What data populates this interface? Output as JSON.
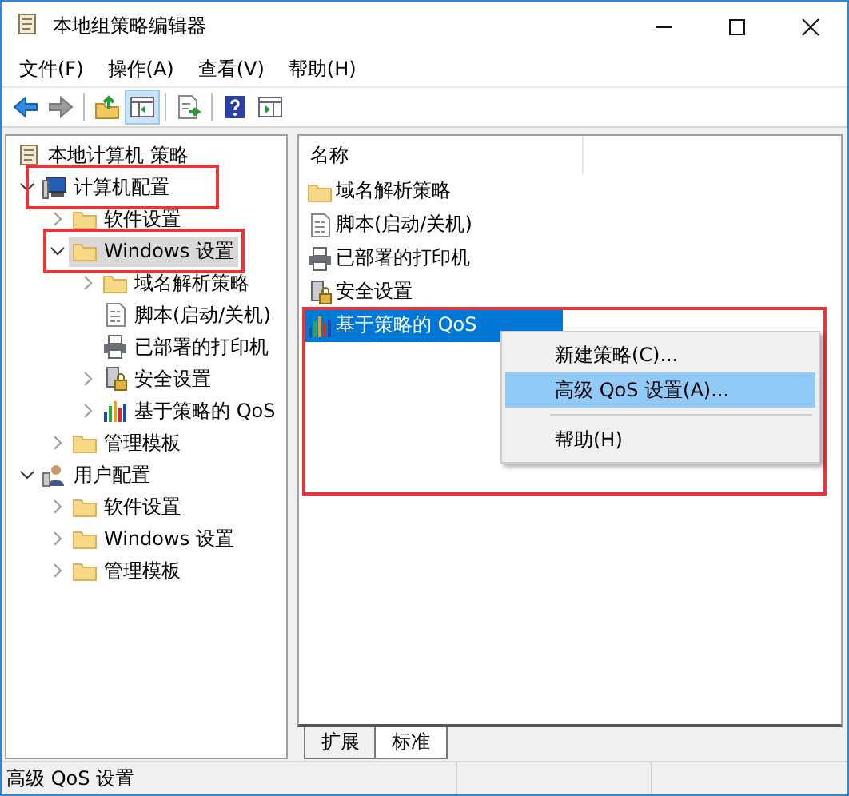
{
  "window": {
    "title": "本地组策略编辑器"
  },
  "menu": [
    "文件(F)",
    "操作(A)",
    "查看(V)",
    "帮助(H)"
  ],
  "toolbar": [
    {
      "kind": "back",
      "disabled": false,
      "pressed": false
    },
    {
      "kind": "forward",
      "disabled": true,
      "pressed": false
    },
    {
      "kind": "sep"
    },
    {
      "kind": "up",
      "disabled": false,
      "pressed": false
    },
    {
      "kind": "tree",
      "disabled": false,
      "pressed": true
    },
    {
      "kind": "sep"
    },
    {
      "kind": "export",
      "disabled": false,
      "pressed": false
    },
    {
      "kind": "sep"
    },
    {
      "kind": "help",
      "disabled": false,
      "pressed": false
    },
    {
      "kind": "pane",
      "disabled": false,
      "pressed": false
    }
  ],
  "tree": [
    {
      "label": "本地计算机 策略",
      "kind": "policy",
      "selected": false,
      "annotated": false,
      "children": [
        {
          "label": "计算机配置",
          "kind": "computer",
          "expanded": true,
          "selected": false,
          "annotated": true,
          "children": [
            {
              "label": "软件设置",
              "kind": "folder",
              "expanded": false,
              "selected": false,
              "annotated": false
            },
            {
              "label": "Windows 设置",
              "kind": "folder",
              "expanded": true,
              "selected": true,
              "annotated": true,
              "children": [
                {
                  "label": "域名解析策略",
                  "kind": "folder",
                  "expanded": false,
                  "selected": false,
                  "annotated": false
                },
                {
                  "label": "脚本(启动/关机)",
                  "kind": "script",
                  "selected": false,
                  "annotated": false
                },
                {
                  "label": "已部署的打印机",
                  "kind": "printer",
                  "selected": false,
                  "annotated": false
                },
                {
                  "label": "安全设置",
                  "kind": "security",
                  "expanded": false,
                  "selected": false,
                  "annotated": false
                },
                {
                  "label": "基于策略的 QoS",
                  "kind": "qos",
                  "expanded": false,
                  "selected": false,
                  "annotated": false
                }
              ]
            },
            {
              "label": "管理模板",
              "kind": "folder",
              "expanded": false,
              "selected": false,
              "annotated": false
            }
          ]
        },
        {
          "label": "用户配置",
          "kind": "user",
          "expanded": true,
          "selected": false,
          "annotated": false,
          "children": [
            {
              "label": "软件设置",
              "kind": "folder",
              "expanded": false,
              "selected": false,
              "annotated": false
            },
            {
              "label": "Windows 设置",
              "kind": "folder",
              "expanded": false,
              "selected": false,
              "annotated": false
            },
            {
              "label": "管理模板",
              "kind": "folder",
              "expanded": false,
              "selected": false,
              "annotated": false
            }
          ]
        }
      ]
    }
  ],
  "list": {
    "column": "名称",
    "annotated": true,
    "items": [
      {
        "label": "域名解析策略",
        "kind": "folder",
        "selected": false
      },
      {
        "label": "脚本(启动/关机)",
        "kind": "script",
        "selected": false
      },
      {
        "label": "已部署的打印机",
        "kind": "printer",
        "selected": false
      },
      {
        "label": "安全设置",
        "kind": "security",
        "selected": false
      },
      {
        "label": "基于策略的 QoS",
        "kind": "qos",
        "selected": true
      }
    ]
  },
  "context_menu": [
    {
      "kind": "item",
      "label": "新建策略(C)...",
      "selected": false
    },
    {
      "kind": "item",
      "label": "高级 QoS 设置(A)...",
      "selected": true
    },
    {
      "kind": "separator"
    },
    {
      "kind": "item",
      "label": "帮助(H)",
      "selected": false
    }
  ],
  "tabs": [
    {
      "label": "扩展",
      "selected": false
    },
    {
      "label": "标准",
      "selected": true
    }
  ],
  "status_bar": "高级 QoS 设置"
}
